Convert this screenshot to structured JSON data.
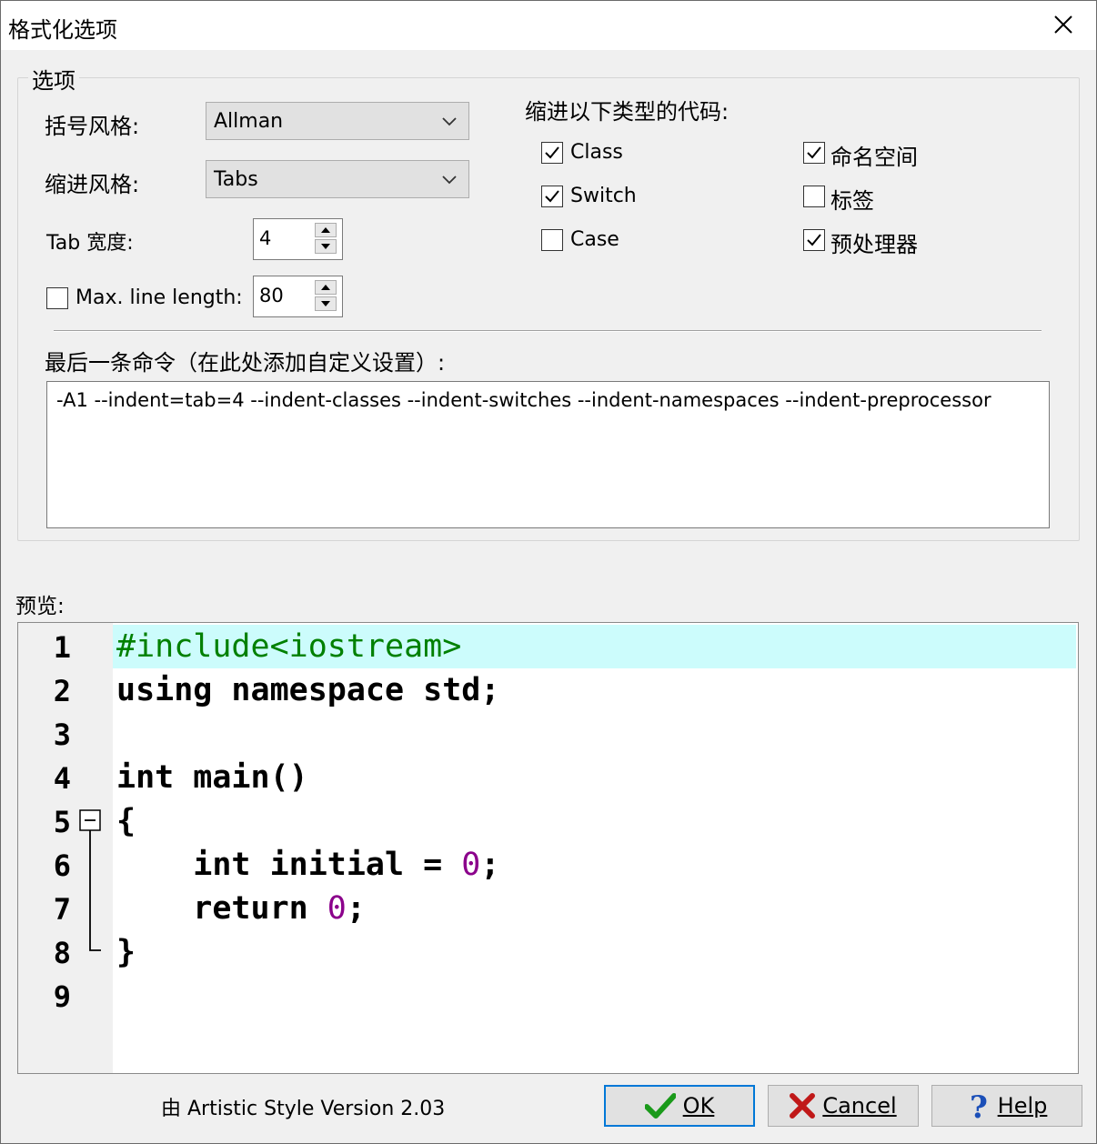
{
  "window": {
    "title": "格式化选项"
  },
  "options": {
    "group_title": "选项",
    "bracket_style_label": "括号风格:",
    "bracket_style_value": "Allman",
    "indent_style_label": "缩进风格:",
    "indent_style_value": "Tabs",
    "tab_width_label": "Tab 宽度:",
    "tab_width_value": "4",
    "max_line_label": "Max. line length:",
    "max_line_value": "80",
    "indent_types_label": "缩进以下类型的代码:",
    "checks": [
      {
        "label": "Class",
        "checked": true
      },
      {
        "label": "Switch",
        "checked": true
      },
      {
        "label": "Case",
        "checked": false
      },
      {
        "label": "命名空间",
        "checked": true
      },
      {
        "label": "标签",
        "checked": false
      },
      {
        "label": "预处理器",
        "checked": true
      }
    ],
    "max_line_checked": false,
    "command_label": "最后一条命令（在此处添加自定义设置）:",
    "command_value": "-A1 --indent=tab=4 --indent-classes --indent-switches --indent-namespaces --indent-preprocessor"
  },
  "preview": {
    "label": "预览:",
    "line_numbers": [
      "1",
      "2",
      "3",
      "4",
      "5",
      "6",
      "7",
      "8",
      "9"
    ],
    "lines": {
      "l1": "#include<iostream>",
      "l2": "using namespace std;",
      "l4": "int main()",
      "l5": "{",
      "l6a": "    int initial = ",
      "l6num": "0",
      "l6b": ";",
      "l7a": "    return ",
      "l7num": "0",
      "l7b": ";",
      "l8": "}"
    }
  },
  "footer": {
    "version_text": "由 Artistic Style Version 2.03",
    "ok_label": "OK",
    "cancel_label": "Cancel",
    "help_label": "Help"
  },
  "colors": {
    "highlight": "#ccfcfc",
    "preprocessor": "#008000",
    "number": "#8b008b",
    "default_button_border": "#0078d7"
  }
}
